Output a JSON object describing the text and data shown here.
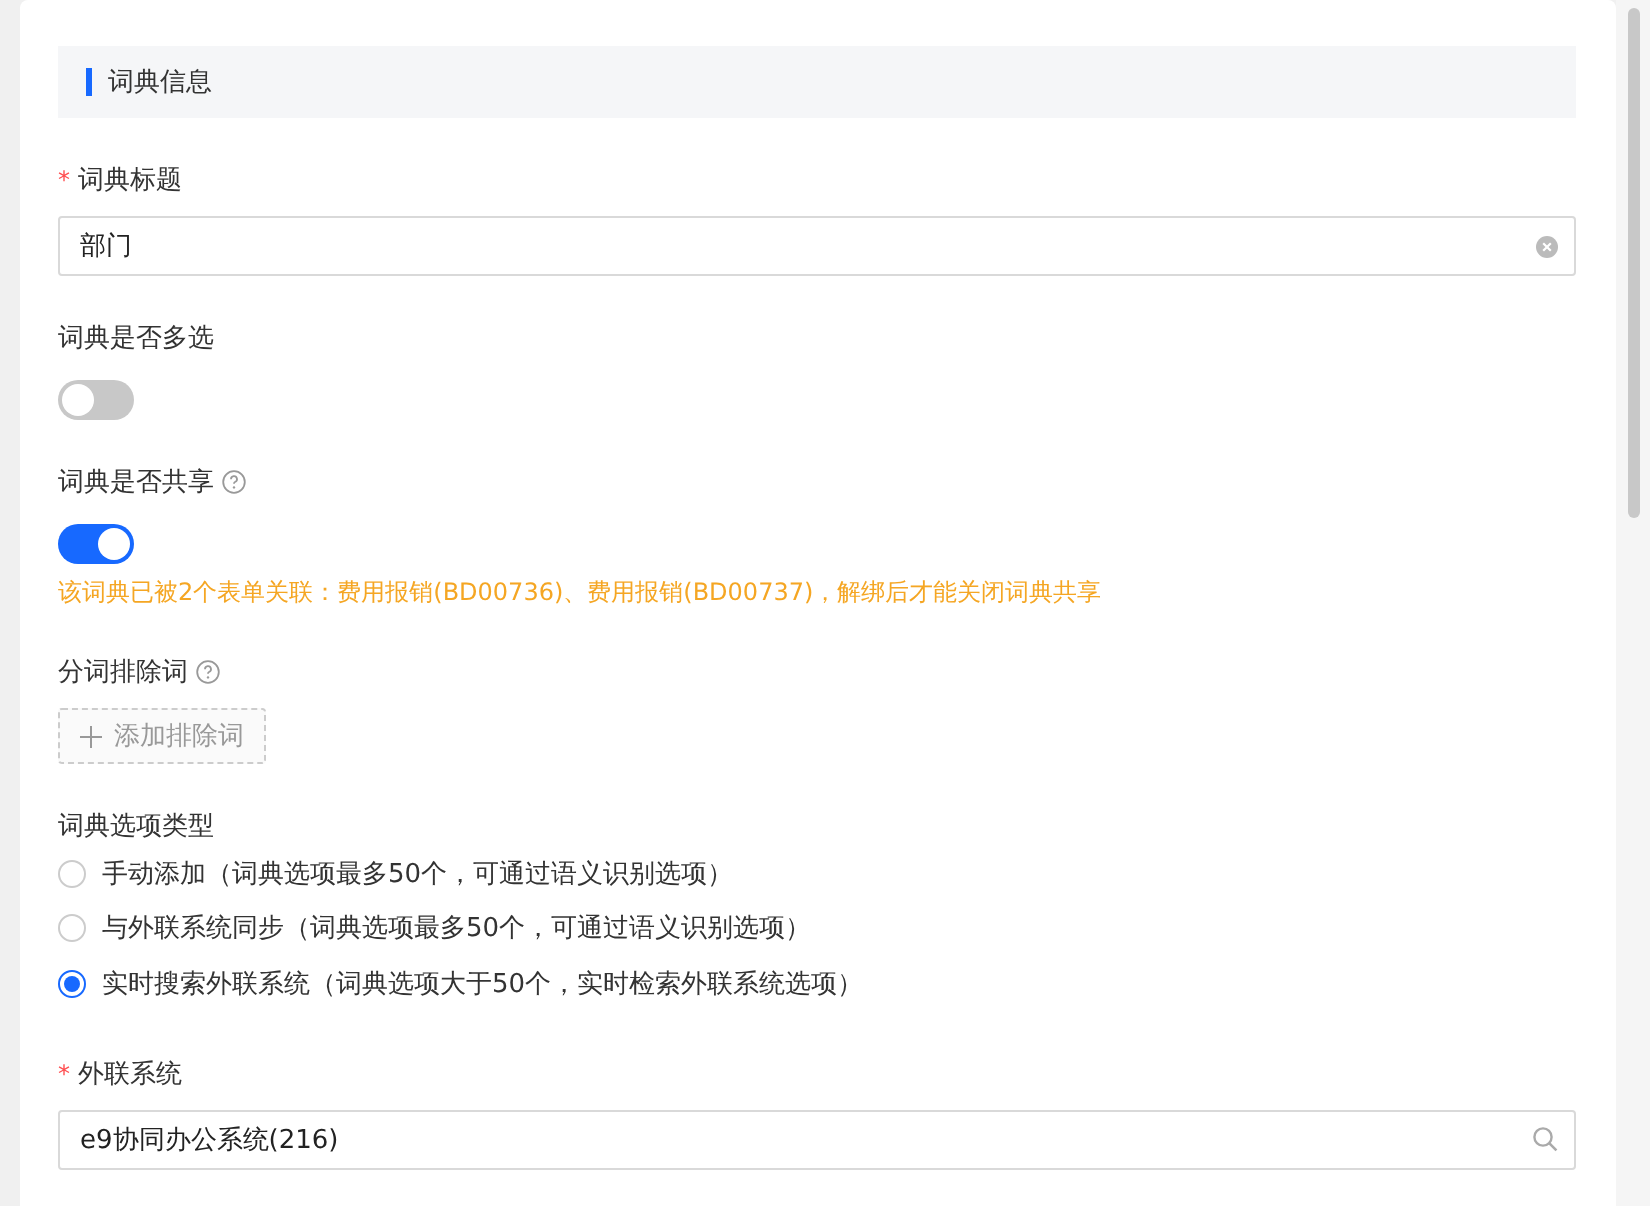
{
  "section": {
    "title": "词典信息"
  },
  "fields": [
    {
      "kind": "input",
      "label": "词典标题",
      "required_mark": "*",
      "value": "部门"
    },
    {
      "kind": "toggle",
      "label": "词典是否多选",
      "on": false
    },
    {
      "kind": "toggle",
      "label": "词典是否共享",
      "help": true,
      "on": true,
      "warning": "该词典已被2个表单关联：费用报销(BD00736)、费用报销(BD00737)，解绑后才能关闭词典共享"
    },
    {
      "kind": "add",
      "label": "分词排除词",
      "help": true,
      "button": "添加排除词"
    },
    {
      "kind": "radio",
      "label": "词典选项类型",
      "options": [
        {
          "label": "手动添加（词典选项最多50个，可通过语义识别选项）",
          "selected": false
        },
        {
          "label": "与外联系统同步（词典选项最多50个，可通过语义识别选项）",
          "selected": false
        },
        {
          "label": "实时搜索外联系统（词典选项大于50个，实时检索外联系统选项）",
          "selected": true
        }
      ]
    },
    {
      "kind": "search",
      "label": "外联系统",
      "required_mark": "*",
      "value": "e9协同办公系统(216)"
    }
  ]
}
